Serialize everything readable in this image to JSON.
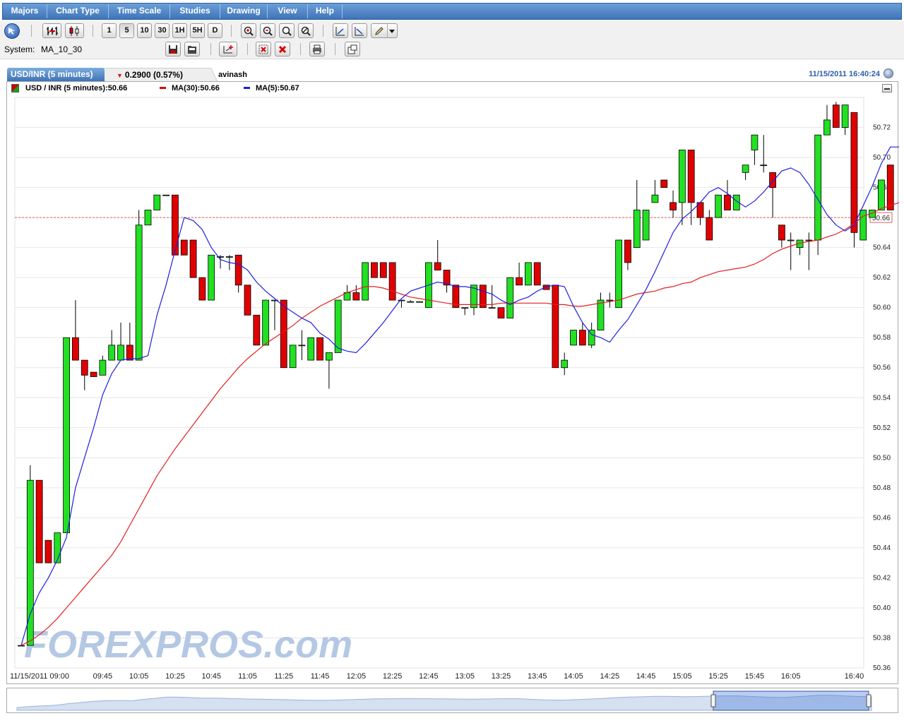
{
  "menu": {
    "items": [
      "Majors",
      "Chart Type",
      "Time Scale",
      "Studies",
      "Drawing",
      "View",
      "Help"
    ]
  },
  "toolbar": {
    "interval_buttons": [
      "1",
      "5",
      "10",
      "30",
      "1H",
      "5H",
      "D"
    ],
    "system_label": "System:",
    "system_value": "MA_10_30"
  },
  "tab": {
    "title": "USD/INR (5 minutes)",
    "change": "0.2900 (0.57%)",
    "change_direction": "down",
    "user": "avinash",
    "timestamp": "11/15/2011 16:40:24"
  },
  "legend": {
    "main": "USD / INR (5 minutes):50.66",
    "ma30": "MA(30):50.66",
    "ma5": "MA(5):50.67"
  },
  "watermark": "FOREXPROS.com",
  "colors": {
    "up": "#22e022",
    "down": "#e00000",
    "ma30": "#e02020",
    "ma5": "#1f1fe0",
    "menu_blue": "#4a7fc1",
    "last_price_line": "#e06060"
  },
  "chart_data": {
    "type": "candlestick",
    "symbol": "USD/INR",
    "interval": "5 minutes",
    "ylim": [
      50.36,
      50.74
    ],
    "y_ticks": [
      50.36,
      50.38,
      50.4,
      50.42,
      50.44,
      50.46,
      50.48,
      50.5,
      50.52,
      50.54,
      50.56,
      50.58,
      50.6,
      50.62,
      50.64,
      50.66,
      50.68,
      50.7,
      50.72
    ],
    "x_tick_labels": [
      "11/15/2011 09:00",
      "09:45",
      "10:05",
      "10:25",
      "10:45",
      "11:05",
      "11:25",
      "11:45",
      "12:05",
      "12:25",
      "12:45",
      "13:05",
      "13:25",
      "13:45",
      "14:05",
      "14:25",
      "14:45",
      "15:05",
      "15:25",
      "15:45",
      "16:05",
      "16:40"
    ],
    "last_price": 50.66,
    "candles": [
      {
        "o": 50.375,
        "h": 50.375,
        "l": 50.375,
        "c": 50.375
      },
      {
        "o": 50.375,
        "h": 50.495,
        "l": 50.375,
        "c": 50.485
      },
      {
        "o": 50.485,
        "h": 50.485,
        "l": 50.43,
        "c": 50.43
      },
      {
        "o": 50.445,
        "h": 50.445,
        "l": 50.43,
        "c": 50.43
      },
      {
        "o": 50.43,
        "h": 50.45,
        "l": 50.43,
        "c": 50.45
      },
      {
        "o": 50.45,
        "h": 50.58,
        "l": 50.45,
        "c": 50.58
      },
      {
        "o": 50.58,
        "h": 50.605,
        "l": 50.565,
        "c": 50.565
      },
      {
        "o": 50.565,
        "h": 50.565,
        "l": 50.545,
        "c": 50.555
      },
      {
        "o": 50.557,
        "h": 50.557,
        "l": 50.554,
        "c": 50.554
      },
      {
        "o": 50.555,
        "h": 50.568,
        "l": 50.555,
        "c": 50.565
      },
      {
        "o": 50.565,
        "h": 50.585,
        "l": 50.565,
        "c": 50.575
      },
      {
        "o": 50.565,
        "h": 50.59,
        "l": 50.565,
        "c": 50.575
      },
      {
        "o": 50.575,
        "h": 50.59,
        "l": 50.565,
        "c": 50.565
      },
      {
        "o": 50.565,
        "h": 50.665,
        "l": 50.565,
        "c": 50.655
      },
      {
        "o": 50.655,
        "h": 50.665,
        "l": 50.655,
        "c": 50.665
      },
      {
        "o": 50.665,
        "h": 50.675,
        "l": 50.665,
        "c": 50.675
      },
      {
        "o": 50.675,
        "h": 50.675,
        "l": 50.675,
        "c": 50.675
      },
      {
        "o": 50.675,
        "h": 50.675,
        "l": 50.635,
        "c": 50.635
      },
      {
        "o": 50.645,
        "h": 50.645,
        "l": 50.635,
        "c": 50.635
      },
      {
        "o": 50.645,
        "h": 50.645,
        "l": 50.62,
        "c": 50.62
      },
      {
        "o": 50.62,
        "h": 50.62,
        "l": 50.605,
        "c": 50.605
      },
      {
        "o": 50.605,
        "h": 50.635,
        "l": 50.605,
        "c": 50.635
      },
      {
        "o": 50.634,
        "h": 50.635,
        "l": 50.626,
        "c": 50.634
      },
      {
        "o": 50.634,
        "h": 50.635,
        "l": 50.625,
        "c": 50.634
      },
      {
        "o": 50.635,
        "h": 50.635,
        "l": 50.61,
        "c": 50.615
      },
      {
        "o": 50.615,
        "h": 50.615,
        "l": 50.595,
        "c": 50.595
      },
      {
        "o": 50.595,
        "h": 50.595,
        "l": 50.575,
        "c": 50.575
      },
      {
        "o": 50.575,
        "h": 50.605,
        "l": 50.575,
        "c": 50.605
      },
      {
        "o": 50.605,
        "h": 50.605,
        "l": 50.585,
        "c": 50.605
      },
      {
        "o": 50.605,
        "h": 50.605,
        "l": 50.56,
        "c": 50.56
      },
      {
        "o": 50.56,
        "h": 50.575,
        "l": 50.56,
        "c": 50.575
      },
      {
        "o": 50.575,
        "h": 50.585,
        "l": 50.565,
        "c": 50.575
      },
      {
        "o": 50.565,
        "h": 50.58,
        "l": 50.565,
        "c": 50.58
      },
      {
        "o": 50.58,
        "h": 50.58,
        "l": 50.565,
        "c": 50.565
      },
      {
        "o": 50.565,
        "h": 50.57,
        "l": 50.546,
        "c": 50.57
      },
      {
        "o": 50.57,
        "h": 50.605,
        "l": 50.57,
        "c": 50.605
      },
      {
        "o": 50.605,
        "h": 50.615,
        "l": 50.605,
        "c": 50.61
      },
      {
        "o": 50.61,
        "h": 50.615,
        "l": 50.605,
        "c": 50.605
      },
      {
        "o": 50.605,
        "h": 50.63,
        "l": 50.605,
        "c": 50.63
      },
      {
        "o": 50.63,
        "h": 50.63,
        "l": 50.62,
        "c": 50.62
      },
      {
        "o": 50.63,
        "h": 50.63,
        "l": 50.62,
        "c": 50.62
      },
      {
        "o": 50.63,
        "h": 50.63,
        "l": 50.605,
        "c": 50.605
      },
      {
        "o": 50.605,
        "h": 50.605,
        "l": 50.6,
        "c": 50.605
      },
      {
        "o": 50.604,
        "h": 50.605,
        "l": 50.604,
        "c": 50.604
      },
      {
        "o": 50.604,
        "h": 50.604,
        "l": 50.604,
        "c": 50.604
      },
      {
        "o": 50.6,
        "h": 50.63,
        "l": 50.6,
        "c": 50.63
      },
      {
        "o": 50.63,
        "h": 50.645,
        "l": 50.625,
        "c": 50.625
      },
      {
        "o": 50.625,
        "h": 50.625,
        "l": 50.61,
        "c": 50.615
      },
      {
        "o": 50.615,
        "h": 50.615,
        "l": 50.6,
        "c": 50.6
      },
      {
        "o": 50.6,
        "h": 50.6,
        "l": 50.595,
        "c": 50.6
      },
      {
        "o": 50.6,
        "h": 50.615,
        "l": 50.595,
        "c": 50.615
      },
      {
        "o": 50.615,
        "h": 50.615,
        "l": 50.6,
        "c": 50.6
      },
      {
        "o": 50.6,
        "h": 50.615,
        "l": 50.6,
        "c": 50.6
      },
      {
        "o": 50.6,
        "h": 50.6,
        "l": 50.593,
        "c": 50.593
      },
      {
        "o": 50.593,
        "h": 50.62,
        "l": 50.593,
        "c": 50.62
      },
      {
        "o": 50.62,
        "h": 50.63,
        "l": 50.615,
        "c": 50.615
      },
      {
        "o": 50.615,
        "h": 50.63,
        "l": 50.615,
        "c": 50.63
      },
      {
        "o": 50.63,
        "h": 50.63,
        "l": 50.615,
        "c": 50.615
      },
      {
        "o": 50.615,
        "h": 50.615,
        "l": 50.612,
        "c": 50.612
      },
      {
        "o": 50.615,
        "h": 50.615,
        "l": 50.56,
        "c": 50.56
      },
      {
        "o": 50.56,
        "h": 50.57,
        "l": 50.555,
        "c": 50.565
      },
      {
        "o": 50.575,
        "h": 50.585,
        "l": 50.575,
        "c": 50.585
      },
      {
        "o": 50.585,
        "h": 50.59,
        "l": 50.575,
        "c": 50.575
      },
      {
        "o": 50.575,
        "h": 50.59,
        "l": 50.573,
        "c": 50.585
      },
      {
        "o": 50.585,
        "h": 50.61,
        "l": 50.585,
        "c": 50.605
      },
      {
        "o": 50.605,
        "h": 50.61,
        "l": 50.6,
        "c": 50.605
      },
      {
        "o": 50.6,
        "h": 50.645,
        "l": 50.6,
        "c": 50.645
      },
      {
        "o": 50.645,
        "h": 50.645,
        "l": 50.625,
        "c": 50.63
      },
      {
        "o": 50.64,
        "h": 50.685,
        "l": 50.64,
        "c": 50.665
      },
      {
        "o": 50.645,
        "h": 50.665,
        "l": 50.645,
        "c": 50.665
      },
      {
        "o": 50.67,
        "h": 50.685,
        "l": 50.67,
        "c": 50.675
      },
      {
        "o": 50.685,
        "h": 50.685,
        "l": 50.68,
        "c": 50.68
      },
      {
        "o": 50.67,
        "h": 50.678,
        "l": 50.66,
        "c": 50.665
      },
      {
        "o": 50.67,
        "h": 50.705,
        "l": 50.655,
        "c": 50.705
      },
      {
        "o": 50.705,
        "h": 50.705,
        "l": 50.655,
        "c": 50.67
      },
      {
        "o": 50.67,
        "h": 50.67,
        "l": 50.655,
        "c": 50.66
      },
      {
        "o": 50.66,
        "h": 50.665,
        "l": 50.645,
        "c": 50.645
      },
      {
        "o": 50.66,
        "h": 50.675,
        "l": 50.66,
        "c": 50.675
      },
      {
        "o": 50.675,
        "h": 50.685,
        "l": 50.665,
        "c": 50.665
      },
      {
        "o": 50.665,
        "h": 50.675,
        "l": 50.665,
        "c": 50.675
      },
      {
        "o": 50.69,
        "h": 50.695,
        "l": 50.685,
        "c": 50.695
      },
      {
        "o": 50.705,
        "h": 50.715,
        "l": 50.695,
        "c": 50.715
      },
      {
        "o": 50.695,
        "h": 50.715,
        "l": 50.69,
        "c": 50.695
      },
      {
        "o": 50.69,
        "h": 50.69,
        "l": 50.66,
        "c": 50.68
      },
      {
        "o": 50.655,
        "h": 50.655,
        "l": 50.64,
        "c": 50.645
      },
      {
        "o": 50.645,
        "h": 50.65,
        "l": 50.625,
        "c": 50.645
      },
      {
        "o": 50.64,
        "h": 50.645,
        "l": 50.635,
        "c": 50.645
      },
      {
        "o": 50.645,
        "h": 50.65,
        "l": 50.625,
        "c": 50.645
      },
      {
        "o": 50.645,
        "h": 50.715,
        "l": 50.635,
        "c": 50.715
      },
      {
        "o": 50.715,
        "h": 50.735,
        "l": 50.715,
        "c": 50.725
      },
      {
        "o": 50.735,
        "h": 50.737,
        "l": 50.72,
        "c": 50.72
      },
      {
        "o": 50.72,
        "h": 50.735,
        "l": 50.715,
        "c": 50.735
      },
      {
        "o": 50.73,
        "h": 50.73,
        "l": 50.64,
        "c": 50.65
      },
      {
        "o": 50.645,
        "h": 50.665,
        "l": 50.645,
        "c": 50.665
      },
      {
        "o": 50.66,
        "h": 50.665,
        "l": 50.66,
        "c": 50.665
      },
      {
        "o": 50.665,
        "h": 50.685,
        "l": 50.665,
        "c": 50.685
      },
      {
        "o": 50.695,
        "h": 50.695,
        "l": 50.665,
        "c": 50.665
      }
    ],
    "series": [
      {
        "name": "MA(30)",
        "color": "#e02020",
        "values": [
          50.375,
          50.378,
          50.382,
          50.387,
          50.393,
          50.4,
          50.407,
          50.414,
          50.421,
          50.428,
          50.435,
          50.444,
          50.455,
          50.466,
          50.477,
          50.488,
          50.497,
          50.506,
          50.514,
          50.522,
          50.53,
          50.538,
          50.546,
          50.553,
          50.56,
          50.566,
          50.571,
          50.576,
          50.58,
          50.584,
          50.588,
          50.593,
          50.597,
          50.601,
          50.604,
          50.607,
          50.61,
          50.612,
          50.614,
          50.614,
          50.613,
          50.611,
          50.609,
          50.607,
          50.606,
          50.605,
          50.604,
          50.603,
          50.602,
          50.602,
          50.602,
          50.602,
          50.602,
          50.603,
          50.603,
          50.603,
          50.603,
          50.603,
          50.603,
          50.602,
          50.602,
          50.601,
          50.601,
          50.602,
          50.603,
          50.604,
          50.605,
          50.607,
          50.609,
          50.61,
          50.611,
          50.613,
          50.614,
          50.616,
          50.617,
          50.62,
          50.622,
          50.624,
          50.625,
          50.626,
          50.627,
          50.629,
          50.632,
          50.636,
          50.639,
          50.641,
          50.643,
          50.644,
          50.645,
          50.647,
          50.649,
          50.652,
          50.656,
          50.661,
          50.663,
          50.666,
          50.668,
          50.67
        ]
      },
      {
        "name": "MA(5)",
        "color": "#1f1fe0",
        "values": [
          50.375,
          50.396,
          50.41,
          50.42,
          50.432,
          50.447,
          50.48,
          50.5,
          50.52,
          50.542,
          50.556,
          50.565,
          50.566,
          50.566,
          50.568,
          50.595,
          50.615,
          50.638,
          50.66,
          50.658,
          50.652,
          50.64,
          50.632,
          50.63,
          50.629,
          50.625,
          50.617,
          50.611,
          50.606,
          50.601,
          50.597,
          50.593,
          50.59,
          50.583,
          50.579,
          50.573,
          50.571,
          50.57,
          50.576,
          50.583,
          50.59,
          50.598,
          50.606,
          50.611,
          50.613,
          50.615,
          50.617,
          50.616,
          50.614,
          50.614,
          50.613,
          50.611,
          50.609,
          50.605,
          50.602,
          50.605,
          50.607,
          50.611,
          50.614,
          50.615,
          50.614,
          50.601,
          50.59,
          50.582,
          50.58,
          50.577,
          50.585,
          50.592,
          50.602,
          50.612,
          50.624,
          50.637,
          50.65,
          50.659,
          50.664,
          50.67,
          50.677,
          50.68,
          50.676,
          50.671,
          50.667,
          50.671,
          50.677,
          50.684,
          50.691,
          50.693,
          50.69,
          50.682,
          50.672,
          50.662,
          50.655,
          50.651,
          50.655,
          50.668,
          50.681,
          50.696,
          50.707,
          50.707,
          50.7,
          50.688,
          50.679,
          50.674,
          50.67
        ]
      }
    ]
  }
}
